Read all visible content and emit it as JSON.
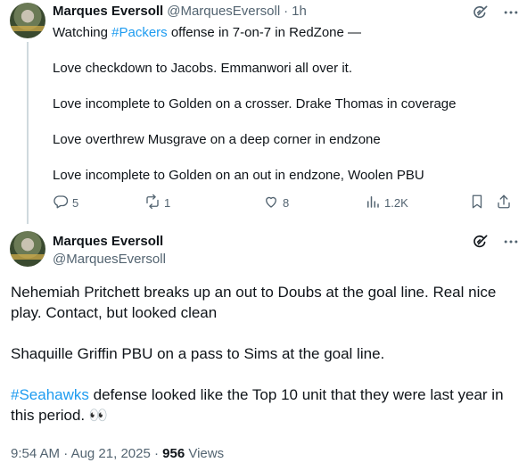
{
  "tweet1": {
    "name": "Marques Eversoll",
    "handle": "@MarquesEversoll",
    "dot": "·",
    "time": "1h",
    "intro_prefix": "Watching ",
    "intro_hashtag": "#Packers",
    "intro_suffix": " offense in 7-on-7 in RedZone —",
    "lines": [
      "Love checkdown to Jacobs. Emmanwori all over it.",
      "Love incomplete to Golden on a crosser. Drake Thomas in coverage",
      "Love overthrew Musgrave on a deep corner in endzone",
      "Love incomplete to Golden on an out in endzone, Woolen PBU"
    ],
    "replies": "5",
    "reposts": "1",
    "likes": "8",
    "views": "1.2K",
    "icons": [
      "grok-icon",
      "more-icon",
      "reply-icon",
      "repost-icon",
      "like-icon",
      "views-icon",
      "bookmark-icon",
      "share-icon"
    ]
  },
  "tweet2": {
    "name": "Marques Eversoll",
    "handle": "@MarquesEversoll",
    "para1": "Nehemiah Pritchett breaks up an out to Doubs at the goal line. Real nice play. Contact, but looked clean",
    "para2": "Shaquille Griffin PBU on a pass to Sims at the goal line.",
    "para3_hashtag": "#Seahawks",
    "para3_text": " defense looked like the Top 10 unit that they were last year in this period. 👀",
    "time": "9:54 AM",
    "date": "Aug 21, 2025",
    "views_count": "956",
    "views_label": "Views",
    "dot": "·",
    "icons": [
      "grok-icon",
      "more-icon"
    ]
  },
  "colors": {
    "accent": "#1d9bf0",
    "text": "#0f1419",
    "muted": "#536471",
    "thread_line": "#cfd9de"
  }
}
